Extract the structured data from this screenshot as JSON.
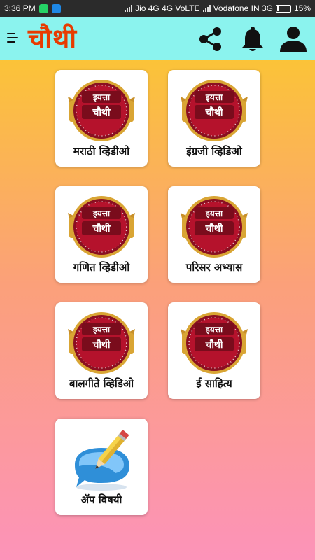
{
  "status_bar": {
    "time": "3:36 PM",
    "carrier1": "Jio 4G 4G VoLTE",
    "carrier2": "Vodafone IN 3G",
    "battery": "15%"
  },
  "app_bar": {
    "title": "चौथी",
    "icons": [
      "menu-icon",
      "share-icon",
      "bell-icon",
      "account-icon"
    ],
    "background": "#8bf3ee",
    "title_color": "#e83b00"
  },
  "badge": {
    "line1": "इयत्ता",
    "line2": "चौथी"
  },
  "cards": [
    {
      "label": "मराठी व्हिडीओ",
      "icon": "class-badge-icon"
    },
    {
      "label": "इंग्रजी व्हिडिओ",
      "icon": "class-badge-icon"
    },
    {
      "label": "गणित व्हिडीओ",
      "icon": "class-badge-icon"
    },
    {
      "label": "परिसर अभ्यास",
      "icon": "class-badge-icon"
    },
    {
      "label": "बालगीते व्हिडिओ",
      "icon": "class-badge-icon"
    },
    {
      "label": "ई साहित्य",
      "icon": "class-badge-icon"
    },
    {
      "label": "ॲप विषयी",
      "icon": "pencil-chat-icon"
    }
  ],
  "colors": {
    "gradient_top": "#fbc338",
    "gradient_bottom": "#fc93b9",
    "badge_red": "#b5122c",
    "badge_gold": "#d9a534"
  }
}
